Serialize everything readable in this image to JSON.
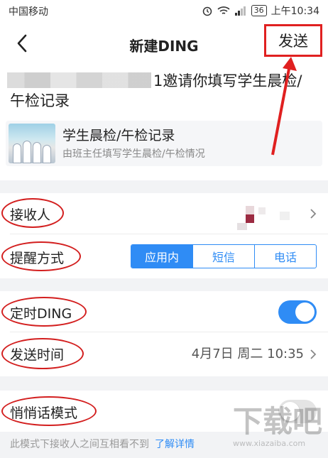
{
  "status_bar": {
    "carrier": "中国移动",
    "battery": "36",
    "time": "上午10:34"
  },
  "nav": {
    "title": "新建DING",
    "send_label": "发送"
  },
  "message": {
    "text": "1邀请你填写学生晨检/午检记录"
  },
  "form_card": {
    "title": "学生晨检/午检记录",
    "description": "由班主任填写学生晨检/午检情况"
  },
  "rows": {
    "recipients_label": "接收人",
    "reminder_label": "提醒方式",
    "reminder_options": [
      "应用内",
      "短信",
      "电话"
    ],
    "reminder_selected": "应用内",
    "scheduled_label": "定时DING",
    "send_time_label": "发送时间",
    "send_time_value": "4月7日 周二 10:35",
    "whisper_label": "悄悄话模式"
  },
  "note": {
    "text": "此模式下接收人之间互相看不到",
    "link": "了解详情"
  },
  "watermark": {
    "text": "下载吧",
    "url_text": "www.xiazaiba.com"
  },
  "colors": {
    "accent": "#2f8cf5",
    "annotation_red": "#d31f1f"
  }
}
